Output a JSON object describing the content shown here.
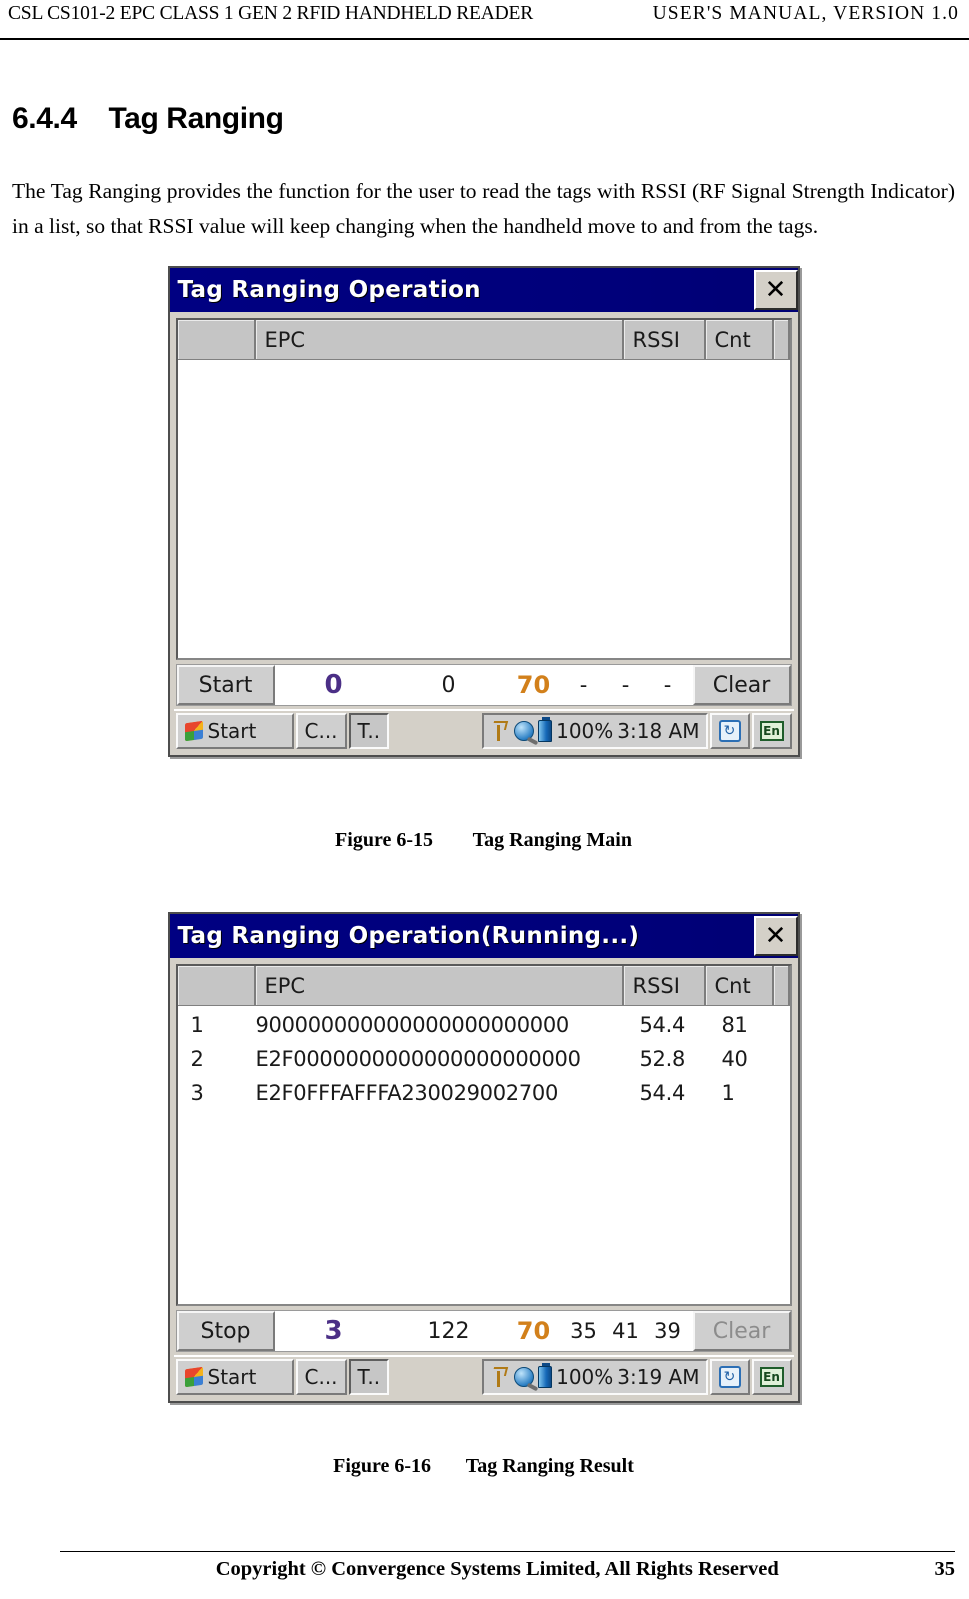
{
  "header": {
    "left": "CSL CS101-2 EPC CLASS 1 GEN 2 RFID HANDHELD READER",
    "right": "USER'S  MANUAL,  VERSION  1.0"
  },
  "section": {
    "number": "6.4.4",
    "title": "Tag Ranging",
    "heading_full": "6.4.4    Tag Ranging",
    "paragraph": "The Tag Ranging provides the function for the user to read the tags with RSSI (RF Signal Strength Indicator) in a list, so that RSSI value will keep changing when the handheld move to and from the tags."
  },
  "figures": [
    {
      "caption_label": "Figure 6-15",
      "caption_text": "Tag Ranging Main",
      "caption_full": "Figure 6-15     Tag Ranging Main",
      "window": {
        "title": "Tag Ranging Operation",
        "close_label": "✕",
        "columns": [
          "",
          "EPC",
          "RSSI",
          "Cnt"
        ],
        "rows": [],
        "statusbar": {
          "action_button": "Start",
          "tag_count": "0",
          "total_reads": "0",
          "power": "70",
          "field1": "-",
          "field2": "-",
          "field3": "-",
          "clear_button": "Clear",
          "clear_disabled": false
        },
        "taskbar": {
          "start_label": "Start",
          "task1": "C...",
          "task2": "T..",
          "battery": "100%",
          "time": "3:18 AM",
          "refresh_icon_label": "↻",
          "keyboard_icon_label": "En"
        }
      }
    },
    {
      "caption_label": "Figure 6-16",
      "caption_text": "Tag Ranging Result",
      "caption_full": "Figure 6-16    Tag Ranging Result",
      "window": {
        "title": "Tag Ranging Operation(Running...)",
        "close_label": "✕",
        "columns": [
          "",
          "EPC",
          "RSSI",
          "Cnt"
        ],
        "rows": [
          {
            "index": "1",
            "epc": "900000000000000000000000",
            "rssi": "54.4",
            "cnt": "81"
          },
          {
            "index": "2",
            "epc": "E2F0000000000000000000000",
            "rssi": "52.8",
            "cnt": "40"
          },
          {
            "index": "3",
            "epc": "E2F0FFFAFFFA230029002700",
            "rssi": "54.4",
            "cnt": "1"
          }
        ],
        "statusbar": {
          "action_button": "Stop",
          "tag_count": "3",
          "total_reads": "122",
          "power": "70",
          "field1": "35",
          "field2": "41",
          "field3": "39",
          "clear_button": "Clear",
          "clear_disabled": true
        },
        "taskbar": {
          "start_label": "Start",
          "task1": "C...",
          "task2": "T..",
          "battery": "100%",
          "time": "3:19 AM",
          "refresh_icon_label": "↻",
          "keyboard_icon_label": "En"
        }
      }
    }
  ],
  "footer": {
    "copyright": "Copyright © Convergence Systems Limited, All Rights Reserved",
    "page_number": "35"
  },
  "colors": {
    "titlebar": "#00007e",
    "count_accent": "#4b2f86",
    "power_accent": "#d2801b",
    "window_chrome": "#d4d0c8"
  }
}
